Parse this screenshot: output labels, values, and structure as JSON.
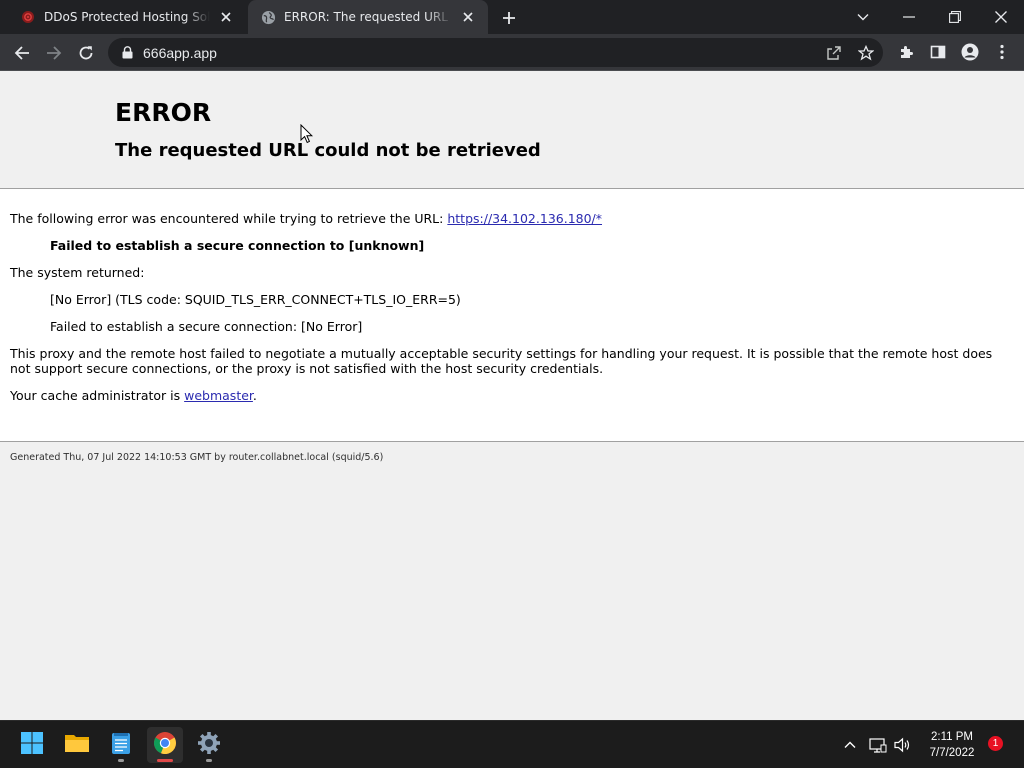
{
  "tabs": [
    {
      "title": "DDoS Protected Hosting Solutions",
      "active": false
    },
    {
      "title": "ERROR: The requested URL could not be retrieved",
      "active": true
    }
  ],
  "toolbar": {
    "url": "666app.app"
  },
  "page": {
    "heading": "ERROR",
    "subheading": "The requested URL could not be retrieved",
    "intro_text": "The following error was encountered while trying to retrieve the URL: ",
    "intro_link": "https://34.102.136.180/*",
    "error_title": "Failed to establish a secure connection to [unknown]",
    "system_returned": "The system returned:",
    "tls_code": "[No Error] (TLS code: SQUID_TLS_ERR_CONNECT+TLS_IO_ERR=5)",
    "secure_conn": "Failed to establish a secure connection: [No Error]",
    "explanation": "This proxy and the remote host failed to negotiate a mutually acceptable security settings for handling your request. It is possible that the remote host does not support secure connections, or the proxy is not satisfied with the host security credentials.",
    "admin_text": "Your cache administrator is ",
    "admin_link": "webmaster",
    "admin_end": ".",
    "footer": "Generated Thu, 07 Jul 2022 14:10:53 GMT by router.collabnet.local (squid/5.6)"
  },
  "taskbar": {
    "apps": [
      "start-icon",
      "file-explorer-icon",
      "notepad-icon",
      "chrome-icon",
      "settings-icon"
    ],
    "clock_time": "2:11 PM",
    "clock_date": "7/7/2022",
    "notification_count": "1"
  },
  "colors": {
    "tab_strip": "#202124",
    "toolbar": "#35363a",
    "page_header_bg": "#f0f0f0",
    "content_bg": "#ffffff",
    "link": "#2b2bb0",
    "taskbar": "#1c1c1c"
  }
}
